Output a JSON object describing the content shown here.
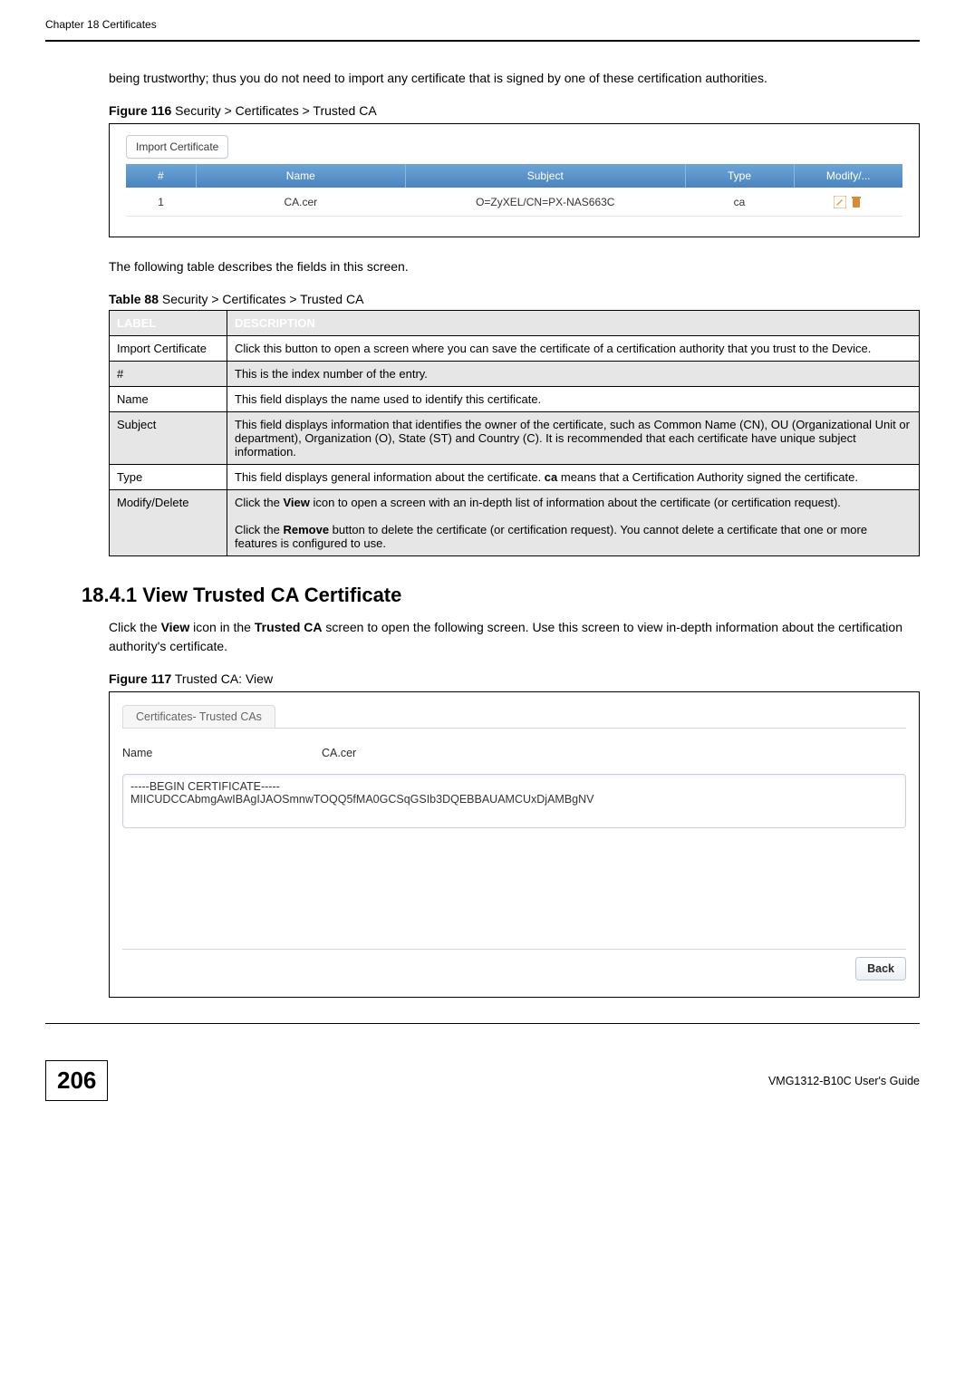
{
  "chapter": "Chapter 18 Certificates",
  "intro_paragraph": "being trustworthy; thus you do not need to import any certificate that is signed by one of these certification authorities.",
  "figure116": {
    "caption_bold": "Figure 116",
    "caption_rest": "   Security > Certificates > Trusted CA",
    "import_button": "Import Certificate",
    "headers": {
      "num": "#",
      "name": "Name",
      "subject": "Subject",
      "type": "Type",
      "modify": "Modify/..."
    },
    "rows": [
      {
        "num": "1",
        "name": "CA.cer",
        "subject": "O=ZyXEL/CN=PX-NAS663C",
        "type": "ca"
      }
    ]
  },
  "table88_intro": "The following table describes the fields in this screen.",
  "table88": {
    "caption_bold": "Table 88",
    "caption_rest": "   Security > Certificates > Trusted CA",
    "header_label": "LABEL",
    "header_desc": "DESCRIPTION",
    "rows": [
      {
        "label": "Import Certificate",
        "desc": "Click this button to open a screen where you can save the certificate of a certification authority that you trust to the Device."
      },
      {
        "label": "#",
        "desc": "This is the index number of the entry."
      },
      {
        "label": "Name",
        "desc": "This field displays the name used to identify this certificate."
      },
      {
        "label": "Subject",
        "desc": "This field displays information that identifies the owner of the certificate, such as Common Name (CN), OU (Organizational Unit or department), Organization (O), State (ST) and Country (C). It is recommended that each certificate have unique subject information."
      },
      {
        "label": "Type",
        "desc_pre": "This field displays general information about the certificate. ",
        "desc_bold": "ca",
        "desc_post": " means that a Certification Authority signed the certificate."
      },
      {
        "label": "Modify/Delete",
        "desc_p1_pre": "Click the ",
        "desc_p1_b": "View",
        "desc_p1_post": " icon to open a screen with an in-depth list of information about the certificate (or certification request).",
        "desc_p2_pre": "Click the ",
        "desc_p2_b": "Remove",
        "desc_p2_post": " button to delete the certificate (or certification request). You cannot delete a certificate that one or more features is configured to use."
      }
    ]
  },
  "section_1841": "18.4.1  View Trusted CA Certificate",
  "section_1841_text_pre": "Click the ",
  "section_1841_text_b1": "View",
  "section_1841_text_mid": " icon in the ",
  "section_1841_text_b2": "Trusted CA",
  "section_1841_text_post": " screen to open the following screen. Use this screen to view in-depth information about the certification authority's certificate.",
  "figure117": {
    "caption_bold": "Figure 117",
    "caption_rest": "   Trusted CA: View",
    "tab": "Certificates- Trusted CAs",
    "name_label": "Name",
    "name_value": "CA.cer",
    "cert_text": "-----BEGIN CERTIFICATE-----\nMIICUDCCAbmgAwIBAgIJAOSmnwTOQQ5fMA0GCSqGSIb3DQEBBAUAMCUxDjAMBgNV",
    "back": "Back"
  },
  "page_number": "206",
  "guide": "VMG1312-B10C User's Guide"
}
